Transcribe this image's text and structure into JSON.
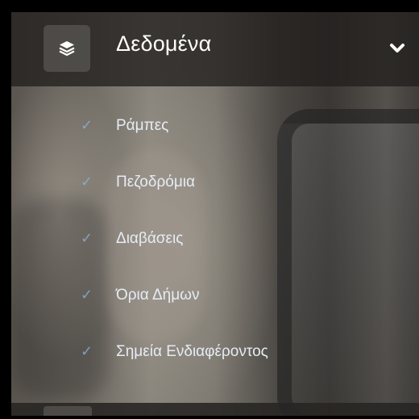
{
  "header": {
    "title": "Δεδομένα",
    "layers_icon": "layers-icon",
    "toggle_icon": "chevron-down-icon"
  },
  "menu": {
    "items": [
      {
        "label": "Ράμπες",
        "icon": "check-icon"
      },
      {
        "label": "Πεζοδρόμια",
        "icon": "check-icon"
      },
      {
        "label": "Διαβάσεις",
        "icon": "check-icon"
      },
      {
        "label": "Όρια Δήμων",
        "icon": "check-icon"
      },
      {
        "label": "Σημεία Ενδιαφέροντος",
        "icon": "check-icon"
      }
    ]
  },
  "colors": {
    "header_bg": "#211f1d",
    "text": "#ffffff",
    "check": "#8fb4d6"
  }
}
